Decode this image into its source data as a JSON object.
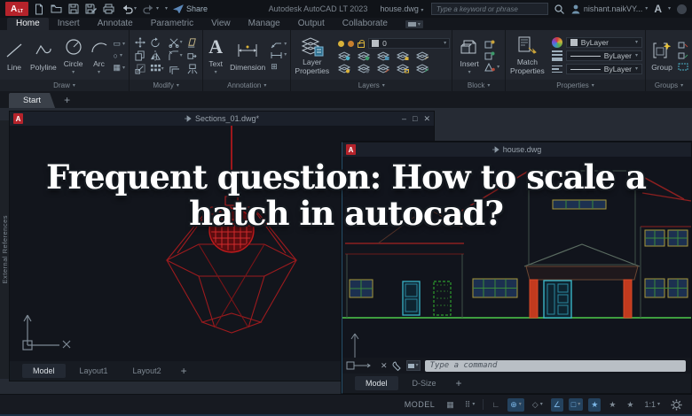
{
  "titlebar": {
    "logo": "A",
    "logo_badge": "LT",
    "share_label": "Share",
    "app_title": "Autodesk AutoCAD LT 2023",
    "doc_name": "house.dwg",
    "search_placeholder": "Type a keyword or phrase",
    "user_name": "nishant.naikVY...",
    "autodesk_mark": "A"
  },
  "ribbon": {
    "tabs": [
      "Home",
      "Insert",
      "Annotate",
      "Parametric",
      "View",
      "Manage",
      "Output",
      "Collaborate"
    ],
    "draw": {
      "label": "Draw",
      "tools": [
        "Line",
        "Polyline",
        "Circle",
        "Arc"
      ]
    },
    "modify": {
      "label": "Modify"
    },
    "annotation": {
      "label": "Annotation",
      "text_tool": "Text",
      "dimension_tool": "Dimension"
    },
    "layers": {
      "label": "Layers",
      "button_line1": "Layer",
      "button_line2": "Properties",
      "current_layer": "0"
    },
    "block": {
      "label": "Block",
      "insert_tool": "Insert"
    },
    "properties": {
      "label": "Properties",
      "button_line1": "Match",
      "button_line2": "Properties",
      "color_value": "ByLayer",
      "lineweight_value": "ByLayer",
      "linetype_value": "ByLayer"
    },
    "groups": {
      "label": "Groups",
      "group_tool": "Group"
    }
  },
  "file_tabs": {
    "start": "Start",
    "new_tab": "+"
  },
  "palette": {
    "title": "External References"
  },
  "sections_window": {
    "title": "Sections_01.dwg*",
    "tabs": [
      "Model",
      "Layout1",
      "Layout2"
    ],
    "new_tab": "+"
  },
  "house_window": {
    "title": "house.dwg",
    "command_placeholder": "Type a command",
    "tabs": [
      "Model",
      "D-Size"
    ],
    "new_tab": "+"
  },
  "overlay": {
    "line1": "Frequent question: How to scale a",
    "line2": "hatch in autocad?"
  },
  "statusbar": {
    "model_label": "MODEL",
    "scale": "1:1"
  },
  "icons": {
    "caret": "▾",
    "close": "✕",
    "minimize": "–",
    "maximize": "□",
    "plus": "+",
    "rect_tool": "▭",
    "ellipse_tool": "○",
    "hatch_tool": "▦",
    "table_tool": "⊞",
    "grid": "▦",
    "snap": "⠿",
    "ortho": "∟",
    "polar": "⊕",
    "isodraft": "◇",
    "otrack": "∠",
    "osnap": "□",
    "annotation_star": "★"
  },
  "colors": {
    "accent_red": "#b5232b",
    "ground_green": "#3f9e3f",
    "roof_red": "#8e2020",
    "column_red": "#c23a1e",
    "door_cyan": "#39b3c6",
    "window_yellow": "#a7973a",
    "pane_blue": "#21375e",
    "lamp_red": "#a81d20"
  }
}
